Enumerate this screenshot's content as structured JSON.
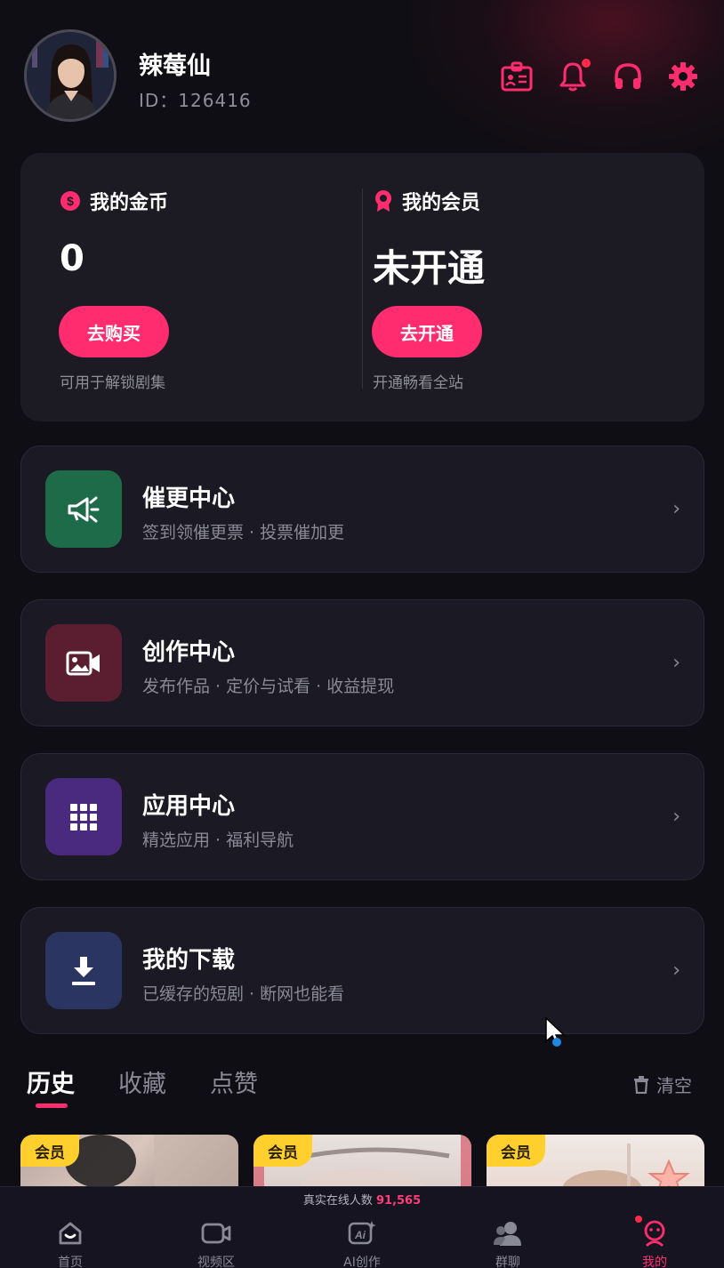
{
  "profile": {
    "username": "辣莓仙",
    "id_text": "ID：126416"
  },
  "header_icons": [
    "id-card-icon",
    "bell-icon",
    "headphones-icon",
    "gear-icon"
  ],
  "wallet": {
    "coins": {
      "title": "我的金币",
      "value": "0",
      "button": "去购买",
      "note": "可用于解锁剧集"
    },
    "membership": {
      "title": "我的会员",
      "value": "未开通",
      "button": "去开通",
      "note": "开通畅看全站"
    }
  },
  "menu": [
    {
      "title": "催更中心",
      "subtitle": "签到领催更票 · 投票催加更",
      "icon": "megaphone-icon",
      "color": "#1e6b4a"
    },
    {
      "title": "创作中心",
      "subtitle": "发布作品 · 定价与试看 · 收益提现",
      "icon": "video-camera-icon",
      "color": "#5a1e30"
    },
    {
      "title": "应用中心",
      "subtitle": "精选应用 · 福利导航",
      "icon": "grid-icon",
      "color": "#4a2a7e"
    },
    {
      "title": "我的下载",
      "subtitle": "已缓存的短剧 · 断网也能看",
      "icon": "download-icon",
      "color": "#2a3562"
    }
  ],
  "tabs": [
    {
      "label": "历史",
      "active": true
    },
    {
      "label": "收藏",
      "active": false
    },
    {
      "label": "点赞",
      "active": false
    }
  ],
  "clear_label": "清空",
  "thumbnails": [
    {
      "badge": "会员"
    },
    {
      "badge": "会员"
    },
    {
      "badge": "会员"
    }
  ],
  "online": {
    "label": "真实在线人数",
    "count": "91,565"
  },
  "bottom_nav": [
    {
      "label": "首页",
      "icon": "home-icon",
      "active": false
    },
    {
      "label": "视频区",
      "icon": "video-icon",
      "active": false
    },
    {
      "label": "AI创作",
      "icon": "ai-create-icon",
      "active": false
    },
    {
      "label": "群聊",
      "icon": "group-chat-icon",
      "active": false
    },
    {
      "label": "我的",
      "icon": "profile-icon",
      "active": true
    }
  ],
  "colors": {
    "accent": "#ff2d6f",
    "background": "#0f0e14",
    "badge": "#ffcf2e"
  }
}
